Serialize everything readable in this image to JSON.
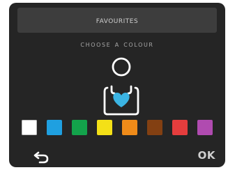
{
  "header": {
    "title": "Favourites"
  },
  "prompt": {
    "text": "Choose a colour"
  },
  "profile_icon": {
    "icon": "person-heart-icon",
    "heart_color": "#3bb4e3",
    "outline_color": "#ffffff"
  },
  "colour_options": [
    {
      "name": "white",
      "color": "#ffffff",
      "selected": true
    },
    {
      "name": "blue",
      "color": "#1fa0e0",
      "selected": false
    },
    {
      "name": "green",
      "color": "#13a34b",
      "selected": false
    },
    {
      "name": "yellow",
      "color": "#f4e017",
      "selected": false
    },
    {
      "name": "orange",
      "color": "#ef8b19",
      "selected": false
    },
    {
      "name": "brown",
      "color": "#834012",
      "selected": false
    },
    {
      "name": "red",
      "color": "#e53d3d",
      "selected": false
    },
    {
      "name": "purple",
      "color": "#b04bb0",
      "selected": false
    }
  ],
  "footer": {
    "back_icon": "back-arrow-icon",
    "ok_label": "OK"
  }
}
